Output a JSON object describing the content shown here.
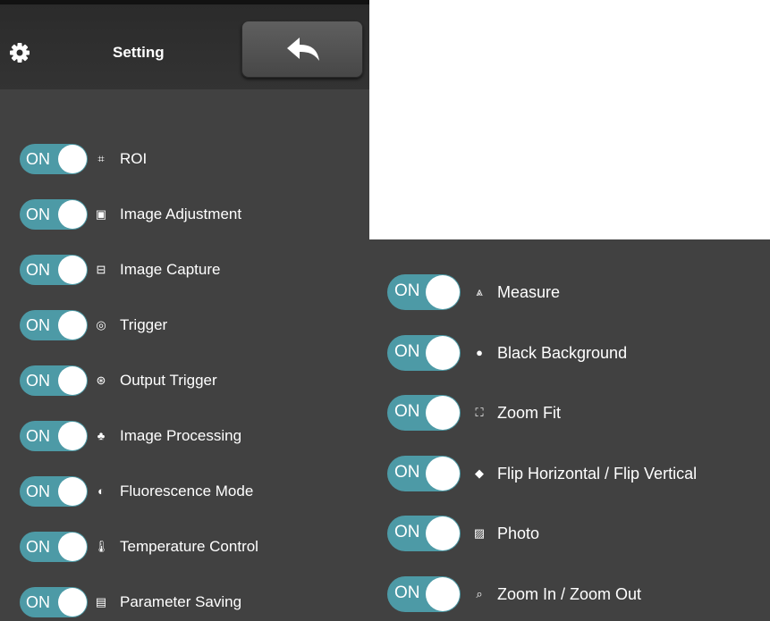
{
  "header": {
    "title": "Setting",
    "settings_icon": "gear-icon",
    "back_icon": "back-arrow-icon"
  },
  "colors": {
    "panel_bg": "#414141",
    "header_bg": "#2b2b2b",
    "toggle_on": "#4d9aa6",
    "text": "#ffffff"
  },
  "left_settings": [
    {
      "label": "ROI",
      "state": "ON",
      "icon": "crop-icon"
    },
    {
      "label": "Image Adjustment",
      "state": "ON",
      "icon": "image-adjust-icon"
    },
    {
      "label": "Image Capture",
      "state": "ON",
      "icon": "capture-icon"
    },
    {
      "label": "Trigger",
      "state": "ON",
      "icon": "trigger-icon"
    },
    {
      "label": "Output Trigger",
      "state": "ON",
      "icon": "output-trigger-icon"
    },
    {
      "label": "Image Processing",
      "state": "ON",
      "icon": "processing-icon"
    },
    {
      "label": "Fluorescence Mode",
      "state": "ON",
      "icon": "fluorescence-icon"
    },
    {
      "label": "Temperature Control",
      "state": "ON",
      "icon": "thermometer-icon"
    },
    {
      "label": "Parameter Saving",
      "state": "ON",
      "icon": "save-parameter-icon"
    }
  ],
  "right_settings": [
    {
      "label": "Measure",
      "state": "ON",
      "icon": "measure-icon"
    },
    {
      "label": "Black Background",
      "state": "ON",
      "icon": "person-icon"
    },
    {
      "label": "Zoom Fit",
      "state": "ON",
      "icon": "zoom-fit-icon"
    },
    {
      "label": "Flip Horizontal / Flip Vertical",
      "state": "ON",
      "icon": "flip-icon"
    },
    {
      "label": "Photo",
      "state": "ON",
      "icon": "photo-icon"
    },
    {
      "label": "Zoom In / Zoom Out",
      "state": "ON",
      "icon": "zoom-icon"
    }
  ]
}
